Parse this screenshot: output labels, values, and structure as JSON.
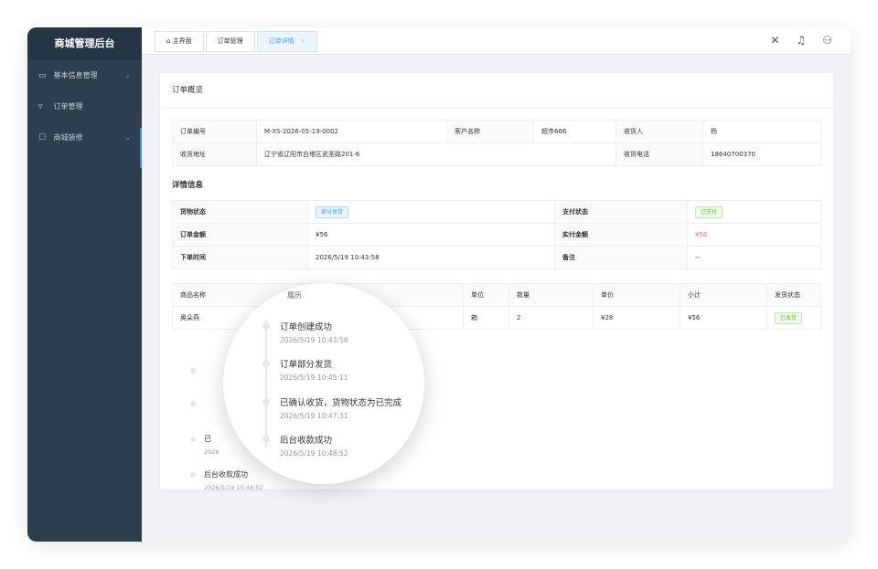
{
  "sidebar": {
    "brand": "商城管理后台",
    "items": [
      {
        "icon": "folder-icon",
        "label": "基本信息管理",
        "has_chevron": true
      },
      {
        "icon": "cart-icon",
        "label": "订单管理",
        "has_chevron": false
      },
      {
        "icon": "edit-icon",
        "label": "商城装修",
        "has_chevron": true
      }
    ]
  },
  "tabs": [
    {
      "label": "主界面",
      "icon": "home-icon"
    },
    {
      "label": "订单管理"
    },
    {
      "label": "订单详情",
      "active": true
    }
  ],
  "top_icons": [
    "close-icon",
    "bell-icon",
    "user-icon"
  ],
  "overview_title": "订单概览",
  "overview": {
    "order_no_label": "订单编号",
    "order_no": "M-XS-2026-05-19-0002",
    "customer_label": "客户名称",
    "customer": "超市666",
    "receiver_label": "收货人",
    "receiver": "杨",
    "address_label": "收货地址",
    "address": "辽宁省辽阳市白塔区武圣路201-6",
    "phone_label": "收货电话",
    "phone": "18640700370"
  },
  "details_title": "详情信息",
  "details": {
    "goods_status_label": "货物状态",
    "goods_status": "部分发货",
    "pay_status_label": "支付状态",
    "pay_status": "已支付",
    "amount_label": "订单金额",
    "amount": "¥56",
    "paid_label": "实付金额",
    "paid": "¥56",
    "order_time_label": "下单时间",
    "order_time": "2026/5/19 10:43:58",
    "remark_label": "备注",
    "remark": "--"
  },
  "goods_table": {
    "headers": [
      "商品名称",
      "单位",
      "数量",
      "单价",
      "小计",
      "发货状态"
    ],
    "rows": [
      {
        "name": "奥朵燕",
        "unit": "箱",
        "qty": "2",
        "price": "¥28",
        "subtotal": "¥56",
        "status": "已发货"
      }
    ]
  },
  "timeline_header_partial": "履历",
  "timeline": [
    {
      "title": "订单创建成功",
      "time": "2026/5/19 10:43:58"
    },
    {
      "title": "订单部分发货",
      "time": "2026/5/19 10:45:11"
    },
    {
      "title": "已确认收货，货物状态为已完成",
      "time": "2026/5/19 10:47:31"
    },
    {
      "title": "后台收款成功",
      "time": "2026/5/19 10:48:52"
    }
  ],
  "timeline_base_partial": {
    "item3_title": "已",
    "item3_time": "2026",
    "item4_title": "后台收款成功",
    "item4_time": "2026/5/19 10:48:52"
  }
}
